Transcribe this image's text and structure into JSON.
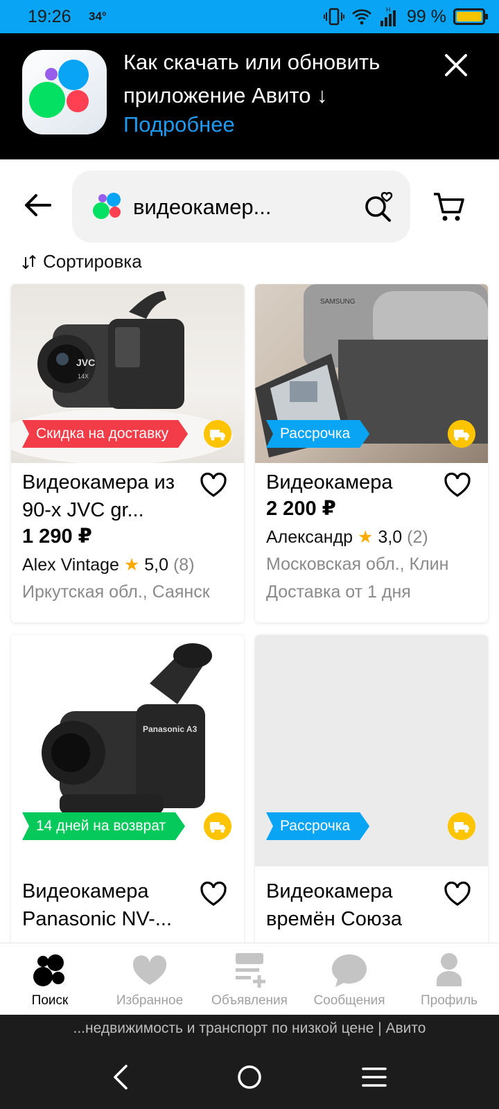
{
  "status_bar": {
    "time": "19:26",
    "temperature": "34°",
    "network": "H",
    "battery": "99 %",
    "battery_level": 0.99
  },
  "banner": {
    "title": "Как скачать или обновить приложение Авито ↓",
    "link": "Подробнее"
  },
  "search": {
    "query": "видеокамер..."
  },
  "sort": {
    "label": "Сортировка"
  },
  "listings": [
    {
      "tag": "Скидка на доставку",
      "tag_color": "#f23c48",
      "title": "Видеокамера из 90-х JVC gr...",
      "price": "1 290 ₽",
      "seller": "Alex Vintage",
      "rating": "5,0",
      "reviews": "(8)",
      "location": "Иркутская обл., Саянск"
    },
    {
      "tag": "Рассрочка",
      "tag_color": "#0aa4f5",
      "title": "Видеокамера",
      "price": "2 200 ₽",
      "seller": "Александр",
      "rating": "3,0",
      "reviews": "(2)",
      "location": "Московская обл., Клин",
      "delivery": "Доставка от 1 дня"
    },
    {
      "tag": "14 дней на возврат",
      "tag_color": "#05c95a",
      "title": "Видеокамера Panasonic NV-..."
    },
    {
      "tag": "Рассрочка",
      "tag_color": "#0aa4f5",
      "title": "Видеокамера времён Союза"
    }
  ],
  "bottom_nav": [
    {
      "label": "Поиск",
      "icon": "search-dots-icon",
      "active": true
    },
    {
      "label": "Избранное",
      "icon": "heart-icon"
    },
    {
      "label": "Объявления",
      "icon": "ads-add-icon"
    },
    {
      "label": "Сообщения",
      "icon": "chat-bubble-icon"
    },
    {
      "label": "Профиль",
      "icon": "profile-icon"
    }
  ],
  "page_title": "...недвижимость и транспорт по низкой цене | Авито",
  "colors": {
    "status_bar": "#0aa4f5",
    "link": "#1e9bf0",
    "delivery_badge": "#ffc400",
    "star": "#ffaa00"
  }
}
